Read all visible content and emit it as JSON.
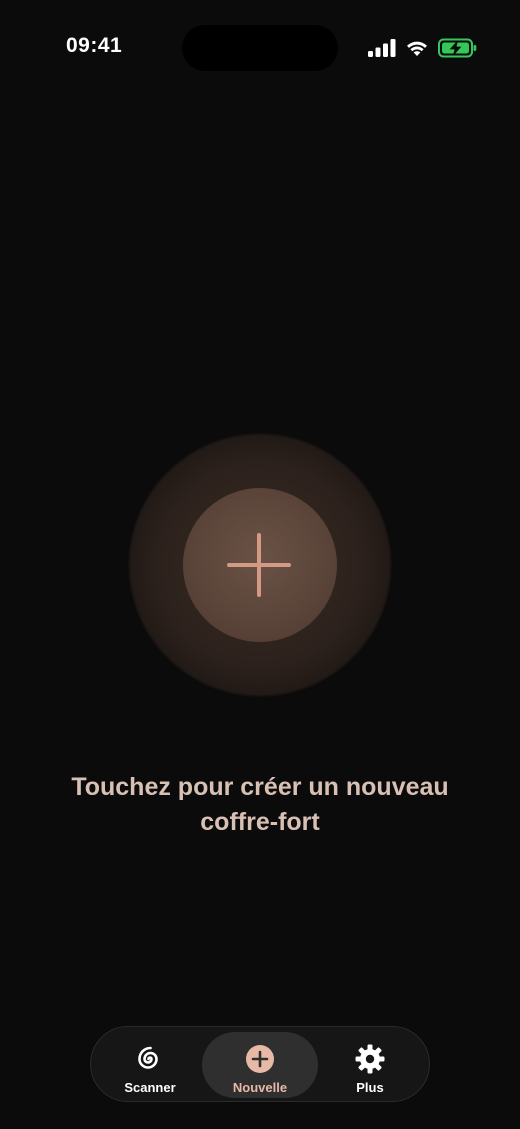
{
  "status_bar": {
    "time": "09:41",
    "icons": [
      "cellular-signal-icon",
      "wifi-icon",
      "battery-charging-icon"
    ],
    "battery_color": "#34c759"
  },
  "main": {
    "create_button_icon": "plus-icon",
    "prompt_text": "Touchez pour créer un nouveau coffre-fort"
  },
  "tab_bar": {
    "tabs": [
      {
        "label": "Scanner",
        "icon": "spiral-icon",
        "selected": false
      },
      {
        "label": "Nouvelle",
        "icon": "plus-circle-icon",
        "selected": true
      },
      {
        "label": "Plus",
        "icon": "gear-icon",
        "selected": false
      }
    ]
  },
  "colors": {
    "background": "#0b0b0b",
    "accent": "#e8b9a6",
    "prompt_text": "#d8c0b4"
  }
}
